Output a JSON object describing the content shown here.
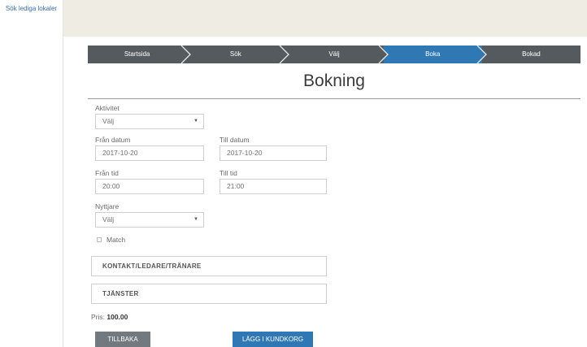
{
  "sidebar": {
    "link_label": "Sök lediga lokaler"
  },
  "steps": [
    {
      "label": "Startsida"
    },
    {
      "label": "Sök"
    },
    {
      "label": "Välj"
    },
    {
      "label": "Boka",
      "active": true
    },
    {
      "label": "Bokad"
    }
  ],
  "page": {
    "title": "Bokning"
  },
  "form": {
    "activity_label": "Aktivitet",
    "activity_value": "Välj",
    "from_date_label": "Från datum",
    "from_date_value": "2017-10-20",
    "to_date_label": "Till datum",
    "to_date_value": "2017-10-20",
    "from_time_label": "Från tid",
    "from_time_value": "20:00",
    "to_time_label": "Till tid",
    "to_time_value": "21:00",
    "user_label": "Nyttjare",
    "user_value": "Välj",
    "match_label": "Match",
    "contact_section": "KONTAKT/LEDARE/TRÄNARE",
    "services_section": "TJÄNSTER",
    "price_label": "Pris:",
    "price_value": "100.00"
  },
  "buttons": {
    "back_label": "TILLBAKA",
    "cart_label": "LÄGG I KUNDKORG"
  },
  "colors": {
    "steps_bg": "#555a5e",
    "step_active": "#2f78b4",
    "topbar": "#efede3",
    "back_button": "#737a7f",
    "cart_button": "#2f78b4"
  }
}
